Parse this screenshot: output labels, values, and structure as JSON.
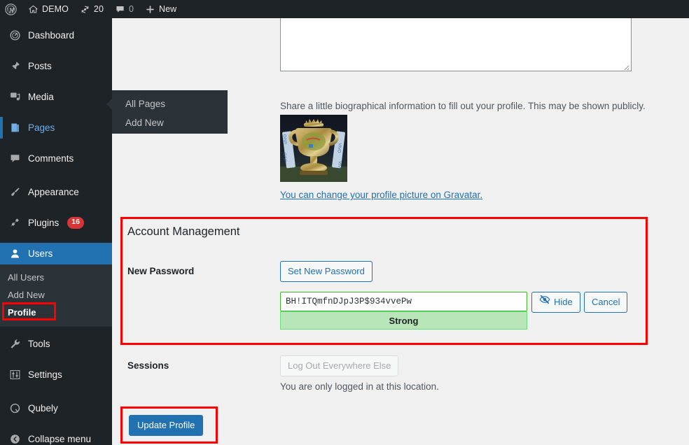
{
  "adminbar": {
    "logo_icon": "wordpress-logo-icon",
    "site": {
      "icon": "home-icon",
      "label": "DEMO"
    },
    "updates": {
      "icon": "updates-icon",
      "count": "20"
    },
    "comments": {
      "icon": "comment-bubble-icon",
      "count": "0"
    },
    "new": {
      "icon": "plus-icon",
      "label": "New"
    }
  },
  "sidebar": {
    "items": [
      {
        "label": "Dashboard",
        "icon": "dashboard-icon",
        "state": "normal"
      },
      {
        "label": "Posts",
        "icon": "pin-icon",
        "state": "normal"
      },
      {
        "label": "Media",
        "icon": "media-icon",
        "state": "normal"
      },
      {
        "label": "Pages",
        "icon": "pages-icon",
        "state": "hover"
      },
      {
        "label": "Comments",
        "icon": "comment-bubble-icon",
        "state": "normal"
      },
      {
        "label": "Appearance",
        "icon": "paintbrush-icon",
        "state": "normal"
      },
      {
        "label": "Plugins",
        "icon": "plug-icon",
        "state": "normal",
        "badge": "16"
      },
      {
        "label": "Users",
        "icon": "user-icon",
        "state": "active"
      },
      {
        "label": "Tools",
        "icon": "wrench-icon",
        "state": "normal"
      },
      {
        "label": "Settings",
        "icon": "sliders-icon",
        "state": "normal"
      },
      {
        "label": "Qubely",
        "icon": "qubely-icon",
        "state": "normal"
      },
      {
        "label": "Collapse menu",
        "icon": "collapse-arrow-icon",
        "state": "normal"
      }
    ],
    "users_submenu": [
      {
        "label": "All Users",
        "current": false
      },
      {
        "label": "Add New",
        "current": false
      },
      {
        "label": "Profile",
        "current": true
      }
    ],
    "pages_flyout": [
      {
        "label": "All Pages"
      },
      {
        "label": "Add New"
      }
    ]
  },
  "main": {
    "bio": {
      "value": "",
      "description": "Share a little biographical information to fill out your profile. This may be shown publicly."
    },
    "avatar": {
      "name": "profile-avatar-trophy",
      "link_text": "You can change your profile picture on Gravatar",
      "link_suffix": "."
    },
    "account_management": {
      "title": "Account Management",
      "new_password_label": "New Password",
      "set_new_password_label": "Set New Password",
      "password_value": "BH!ITQmfnDJpJ3P$934vvePw",
      "strength_label": "Strong",
      "hide_label": "Hide",
      "hide_icon": "eye-slash-icon",
      "cancel_label": "Cancel"
    },
    "sessions": {
      "label": "Sessions",
      "logout_button_label": "Log Out Everywhere Else",
      "note": "You are only logged in at this location."
    },
    "submit": {
      "label": "Update Profile"
    }
  },
  "annotations": {
    "highlight_color": "#fe0000",
    "boxes": [
      {
        "name": "profile-menu-highlight"
      },
      {
        "name": "account-management-highlight"
      },
      {
        "name": "update-profile-highlight"
      }
    ]
  }
}
